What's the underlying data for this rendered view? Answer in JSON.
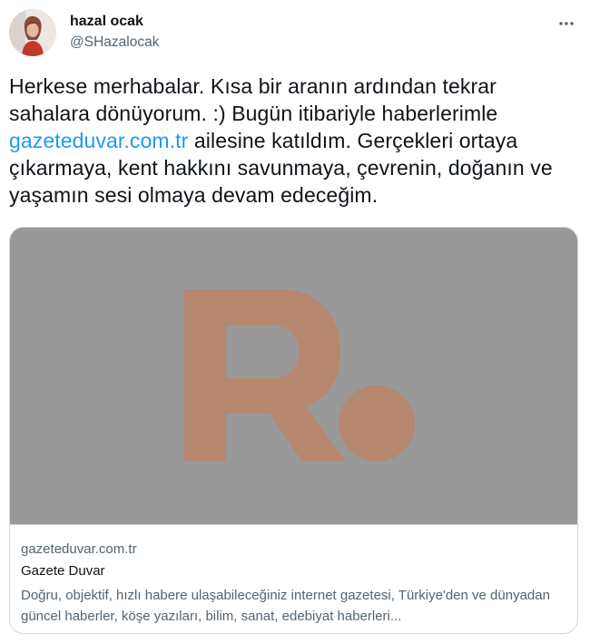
{
  "author": {
    "display_name": "hazal ocak",
    "handle": "@SHazalocak"
  },
  "tweet": {
    "text_before_link": "Herkese merhabalar. Kısa bir aranın ardından tekrar sahalara dönüyorum. :) Bugün itibariyle haberlerimle ",
    "link_text": "gazeteduvar.com.tr",
    "text_after_link": " ailesine katıldım. Gerçekleri ortaya çıkarmaya, kent hakkını savunmaya, çevrenin, doğanın ve yaşamın sesi olmaya devam edeceğim."
  },
  "card": {
    "image_logo_text": "R.",
    "domain": "gazeteduvar.com.tr",
    "title": "Gazete Duvar",
    "description": "Doğru, objektif, hızlı habere ulaşabileceğiniz internet gazetesi, Türkiye'den ve dünyadan güncel haberler, köşe yazıları, bilim, sanat, edebiyat haberleri..."
  },
  "icons": {
    "more": "more-horizontal-icon",
    "logo": "gazete-duvar-logo"
  },
  "colors": {
    "link": "#1d9bf0",
    "text": "#0f1419",
    "secondary": "#536471",
    "card_image_bg": "#999999",
    "logo": "#b5876f",
    "border": "#cfd9de"
  }
}
